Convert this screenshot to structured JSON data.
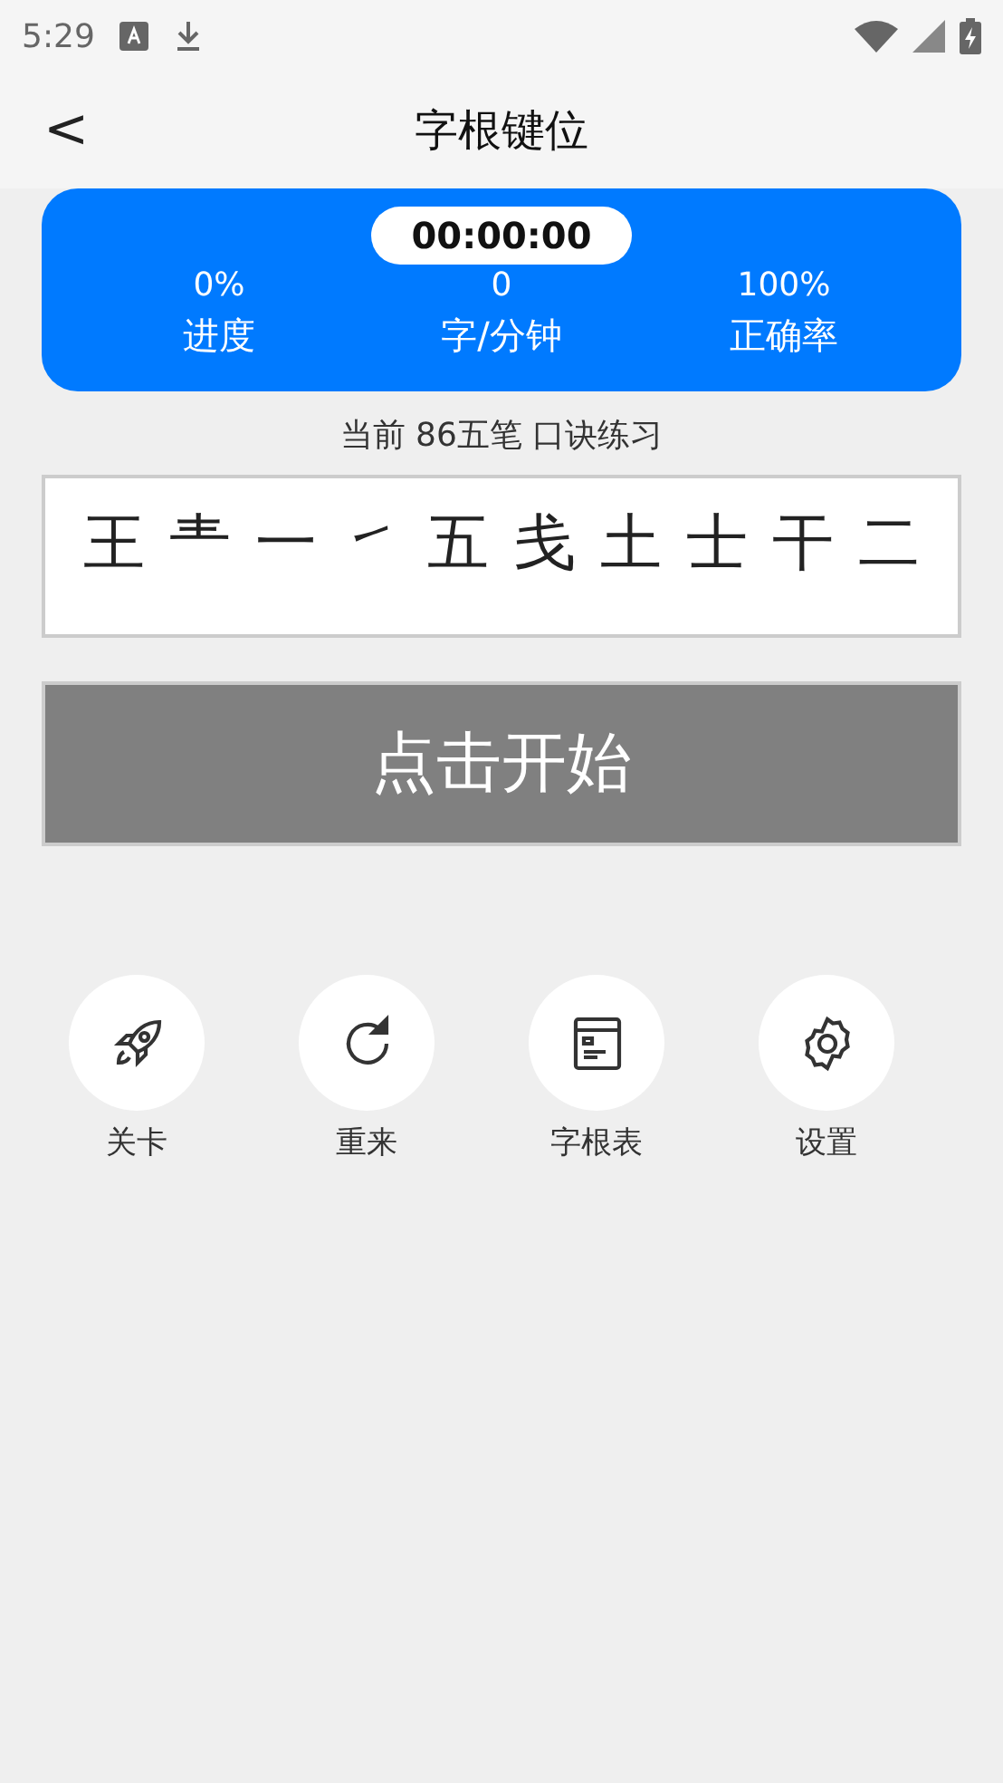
{
  "status_bar": {
    "time": "5:29"
  },
  "header": {
    "back": "<",
    "title": "字根键位"
  },
  "stats": {
    "timer": "00:00:00",
    "items": [
      {
        "value": "0%",
        "label": "进度"
      },
      {
        "value": "0",
        "label": "字/分钟"
      },
      {
        "value": "100%",
        "label": "正确率"
      }
    ]
  },
  "subtitle": "当前 86五笔 口诀练习",
  "radicals": [
    "王",
    "龶",
    "一",
    "㇀",
    "五",
    "戋",
    "土",
    "士",
    "干",
    "二"
  ],
  "start_button": "点击开始",
  "actions": [
    {
      "kind": "rocket",
      "label": "关卡"
    },
    {
      "kind": "refresh",
      "label": "重来"
    },
    {
      "kind": "table",
      "label": "字根表"
    },
    {
      "kind": "settings",
      "label": "设置"
    }
  ]
}
